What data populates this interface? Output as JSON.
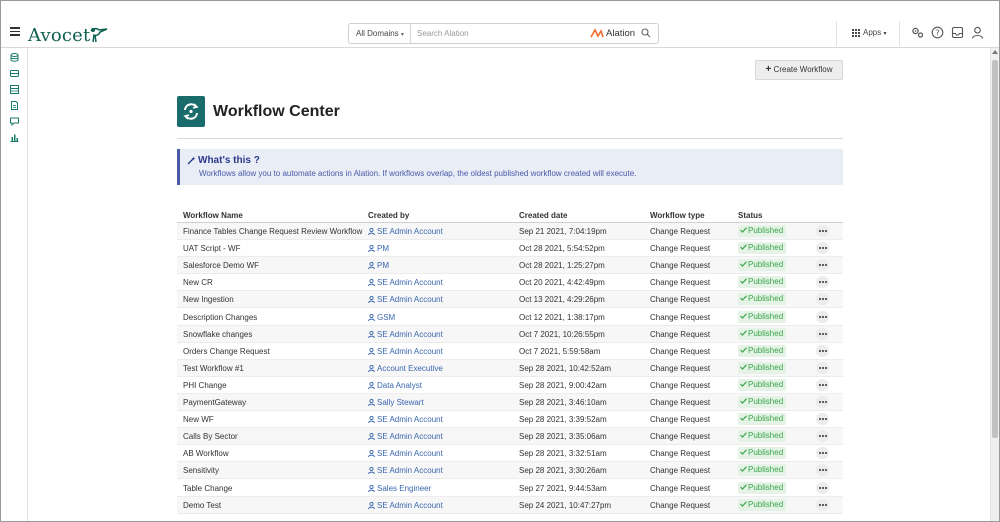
{
  "header": {
    "brand": "Avocet",
    "domains_label": "All Domains",
    "search_placeholder": "Search Alation",
    "search_logo_text": "Alation",
    "apps_label": "Apps"
  },
  "page": {
    "create_button": "Create Workflow",
    "title": "Workflow Center",
    "info_title": "What's this ?",
    "info_text": "Workflows allow you to automate actions in Alation. If workflows overlap, the oldest published workflow created will execute."
  },
  "table": {
    "columns": [
      "Workflow Name",
      "Created by",
      "Created date",
      "Workflow type",
      "Status"
    ],
    "rows": [
      {
        "name": "Finance Tables Change Request Review Workflow",
        "by": "SE Admin Account",
        "date": "Sep 21 2021, 7:04:19pm",
        "type": "Change Request",
        "status": "Published"
      },
      {
        "name": "UAT Script - WF",
        "by": "PM",
        "date": "Oct 28 2021, 5:54:52pm",
        "type": "Change Request",
        "status": "Published"
      },
      {
        "name": "Salesforce Demo WF",
        "by": "PM",
        "date": "Oct 28 2021, 1:25:27pm",
        "type": "Change Request",
        "status": "Published"
      },
      {
        "name": "New CR",
        "by": "SE Admin Account",
        "date": "Oct 20 2021, 4:42:49pm",
        "type": "Change Request",
        "status": "Published"
      },
      {
        "name": "New Ingestion",
        "by": "SE Admin Account",
        "date": "Oct 13 2021, 4:29:26pm",
        "type": "Change Request",
        "status": "Published"
      },
      {
        "name": "Description Changes",
        "by": "GSM",
        "date": "Oct 12 2021, 1:38:17pm",
        "type": "Change Request",
        "status": "Published"
      },
      {
        "name": "Snowflake changes",
        "by": "SE Admin Account",
        "date": "Oct 7 2021, 10:26:55pm",
        "type": "Change Request",
        "status": "Published"
      },
      {
        "name": "Orders Change Request",
        "by": "SE Admin Account",
        "date": "Oct 7 2021, 5:59:58am",
        "type": "Change Request",
        "status": "Published"
      },
      {
        "name": "Test Workflow #1",
        "by": "Account Executive",
        "date": "Sep 28 2021, 10:42:52am",
        "type": "Change Request",
        "status": "Published"
      },
      {
        "name": "PHI Change",
        "by": "Data Analyst",
        "date": "Sep 28 2021, 9:00:42am",
        "type": "Change Request",
        "status": "Published"
      },
      {
        "name": "PaymentGateway",
        "by": "Sally Stewart",
        "date": "Sep 28 2021, 3:46:10am",
        "type": "Change Request",
        "status": "Published"
      },
      {
        "name": "New WF",
        "by": "SE Admin Account",
        "date": "Sep 28 2021, 3:39:52am",
        "type": "Change Request",
        "status": "Published"
      },
      {
        "name": "Calls By Sector",
        "by": "SE Admin Account",
        "date": "Sep 28 2021, 3:35:06am",
        "type": "Change Request",
        "status": "Published"
      },
      {
        "name": "AB Workflow",
        "by": "SE Admin Account",
        "date": "Sep 28 2021, 3:32:51am",
        "type": "Change Request",
        "status": "Published"
      },
      {
        "name": "Sensitivity",
        "by": "SE Admin Account",
        "date": "Sep 28 2021, 3:30:26am",
        "type": "Change Request",
        "status": "Published"
      },
      {
        "name": "Table Change",
        "by": "Sales Engineer",
        "date": "Sep 27 2021, 9:44:53am",
        "type": "Change Request",
        "status": "Published"
      },
      {
        "name": "Demo Test",
        "by": "SE Admin Account",
        "date": "Sep 24 2021, 10:47:27pm",
        "type": "Change Request",
        "status": "Published"
      }
    ]
  },
  "colors": {
    "brand": "#0f5e52",
    "link": "#3a67b0",
    "status_green": "#3aa54a",
    "info_bg": "#e9edf6",
    "info_accent": "#2a3a8c",
    "page_icon": "#1a6b6b"
  }
}
